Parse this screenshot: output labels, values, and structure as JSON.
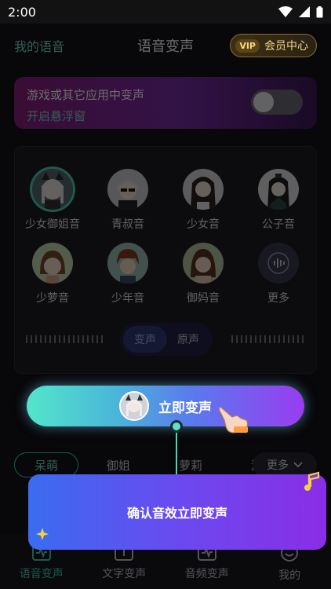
{
  "status": {
    "time": "2:00"
  },
  "header": {
    "my_voice": "我的语音",
    "title": "语音变声",
    "vip_badge": "VIP",
    "vip_center": "会员中心"
  },
  "floating": {
    "line1": "游戏或其它应用中变声",
    "line2": "开启悬浮窗",
    "toggle_on": false
  },
  "voices": [
    {
      "label": "少女御姐音",
      "icon": "avatar-female-cat-ears",
      "selected": true
    },
    {
      "label": "青叔音",
      "icon": "avatar-male-sunglasses"
    },
    {
      "label": "少女音",
      "icon": "avatar-female-long-hair"
    },
    {
      "label": "公子音",
      "icon": "avatar-male-ancient"
    },
    {
      "label": "少萝音",
      "icon": "avatar-little-girl"
    },
    {
      "label": "少年音",
      "icon": "avatar-boy"
    },
    {
      "label": "御妈音",
      "icon": "avatar-woman"
    },
    {
      "label": "更多",
      "icon": "soundwave-icon"
    }
  ],
  "mode": {
    "active": "变声",
    "inactive": "原声"
  },
  "cta": {
    "label": "立即变声"
  },
  "categories": [
    "呆萌",
    "御姐",
    "萝莉",
    "游戏"
  ],
  "more": "更多",
  "tooltip": {
    "text": "确认音效立即变声"
  },
  "tabs": [
    {
      "label": "语音变声",
      "icon": "soundwave-box-icon",
      "selected": true
    },
    {
      "label": "文字变声",
      "icon": "text-box-icon"
    },
    {
      "label": "音频变声",
      "icon": "audio-box-icon"
    },
    {
      "label": "我的",
      "icon": "smile-icon"
    }
  ],
  "colors": {
    "accent": "#46d6b3",
    "background": "#131218",
    "tooltip_start": "#3a6cf0",
    "tooltip_end": "#8a2de6"
  }
}
